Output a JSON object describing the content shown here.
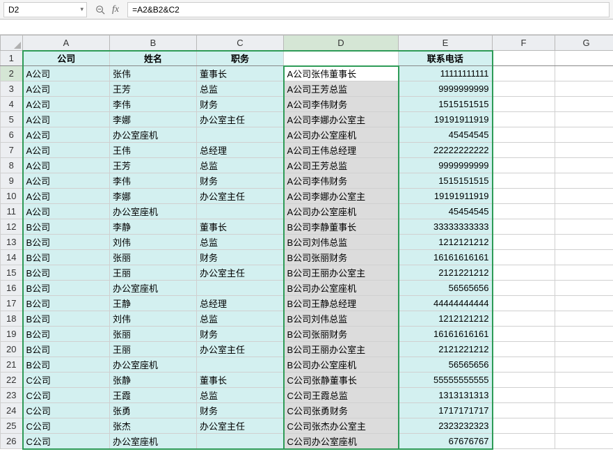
{
  "formula_bar": {
    "cell_ref": "D2",
    "formula": "=A2&B2&C2"
  },
  "columns": [
    "A",
    "B",
    "C",
    "D",
    "E",
    "F",
    "G"
  ],
  "headers": {
    "A": "公司",
    "B": "姓名",
    "C": "职务",
    "D": "",
    "E": "联系电话"
  },
  "chart_data": {
    "type": "table",
    "columns": [
      "公司",
      "姓名",
      "职务",
      "D",
      "联系电话"
    ],
    "rows": [
      {
        "r": 2,
        "A": "A公司",
        "B": "张伟",
        "C": "董事长",
        "D": "A公司张伟董事长",
        "E": "11111111111"
      },
      {
        "r": 3,
        "A": "A公司",
        "B": "王芳",
        "C": "总监",
        "D": "A公司王芳总监",
        "E": "9999999999"
      },
      {
        "r": 4,
        "A": "A公司",
        "B": "李伟",
        "C": "财务",
        "D": "A公司李伟财务",
        "E": "1515151515"
      },
      {
        "r": 5,
        "A": "A公司",
        "B": "李娜",
        "C": "办公室主任",
        "D": "A公司李娜办公室主",
        "E": "19191911919"
      },
      {
        "r": 6,
        "A": "A公司",
        "B": "办公室座机",
        "C": "",
        "D": "A公司办公室座机",
        "E": "45454545"
      },
      {
        "r": 7,
        "A": "A公司",
        "B": "王伟",
        "C": "总经理",
        "D": "A公司王伟总经理",
        "E": "22222222222"
      },
      {
        "r": 8,
        "A": "A公司",
        "B": "王芳",
        "C": "总监",
        "D": "A公司王芳总监",
        "E": "9999999999"
      },
      {
        "r": 9,
        "A": "A公司",
        "B": "李伟",
        "C": "财务",
        "D": "A公司李伟财务",
        "E": "1515151515"
      },
      {
        "r": 10,
        "A": "A公司",
        "B": "李娜",
        "C": "办公室主任",
        "D": "A公司李娜办公室主",
        "E": "19191911919"
      },
      {
        "r": 11,
        "A": "A公司",
        "B": "办公室座机",
        "C": "",
        "D": "A公司办公室座机",
        "E": "45454545"
      },
      {
        "r": 12,
        "A": "B公司",
        "B": "李静",
        "C": "董事长",
        "D": "B公司李静董事长",
        "E": "33333333333"
      },
      {
        "r": 13,
        "A": "B公司",
        "B": "刘伟",
        "C": "总监",
        "D": "B公司刘伟总监",
        "E": "1212121212"
      },
      {
        "r": 14,
        "A": "B公司",
        "B": "张丽",
        "C": "财务",
        "D": "B公司张丽财务",
        "E": "16161616161"
      },
      {
        "r": 15,
        "A": "B公司",
        "B": "王丽",
        "C": "办公室主任",
        "D": "B公司王丽办公室主",
        "E": "2121221212"
      },
      {
        "r": 16,
        "A": "B公司",
        "B": "办公室座机",
        "C": "",
        "D": "B公司办公室座机",
        "E": "56565656"
      },
      {
        "r": 17,
        "A": "B公司",
        "B": "王静",
        "C": "总经理",
        "D": "B公司王静总经理",
        "E": "44444444444"
      },
      {
        "r": 18,
        "A": "B公司",
        "B": "刘伟",
        "C": "总监",
        "D": "B公司刘伟总监",
        "E": "1212121212"
      },
      {
        "r": 19,
        "A": "B公司",
        "B": "张丽",
        "C": "财务",
        "D": "B公司张丽财务",
        "E": "16161616161"
      },
      {
        "r": 20,
        "A": "B公司",
        "B": "王丽",
        "C": "办公室主任",
        "D": "B公司王丽办公室主",
        "E": "2121221212"
      },
      {
        "r": 21,
        "A": "B公司",
        "B": "办公室座机",
        "C": "",
        "D": "B公司办公室座机",
        "E": "56565656"
      },
      {
        "r": 22,
        "A": "C公司",
        "B": "张静",
        "C": "董事长",
        "D": "C公司张静董事长",
        "E": "55555555555"
      },
      {
        "r": 23,
        "A": "C公司",
        "B": "王霞",
        "C": "总监",
        "D": "C公司王霞总监",
        "E": "1313131313"
      },
      {
        "r": 24,
        "A": "C公司",
        "B": "张勇",
        "C": "财务",
        "D": "C公司张勇财务",
        "E": "1717171717"
      },
      {
        "r": 25,
        "A": "C公司",
        "B": "张杰",
        "C": "办公室主任",
        "D": "C公司张杰办公室主",
        "E": "2323232323"
      },
      {
        "r": 26,
        "A": "C公司",
        "B": "办公室座机",
        "C": "",
        "D": "C公司办公室座机",
        "E": "67676767"
      }
    ]
  },
  "selection": {
    "active_cell": "D2",
    "selected_range": "D2:D26"
  }
}
